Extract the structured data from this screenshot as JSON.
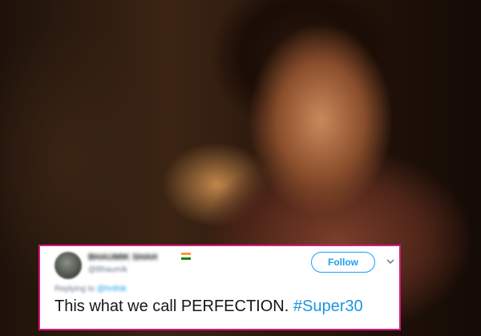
{
  "tweet": {
    "display_name": "BHAUMIK SHAH",
    "handle": "@Bhaumik",
    "follow_label": "Follow",
    "reply_prefix": "Replying to",
    "reply_mention": "@hrithik",
    "text": "This what we call PERFECTION.",
    "hashtag": "#Super30",
    "accent_color": "#1da1f2",
    "border_color": "#d5187d"
  },
  "icons": {
    "flag": "india-flag-icon",
    "more": "chevron-down-icon"
  }
}
